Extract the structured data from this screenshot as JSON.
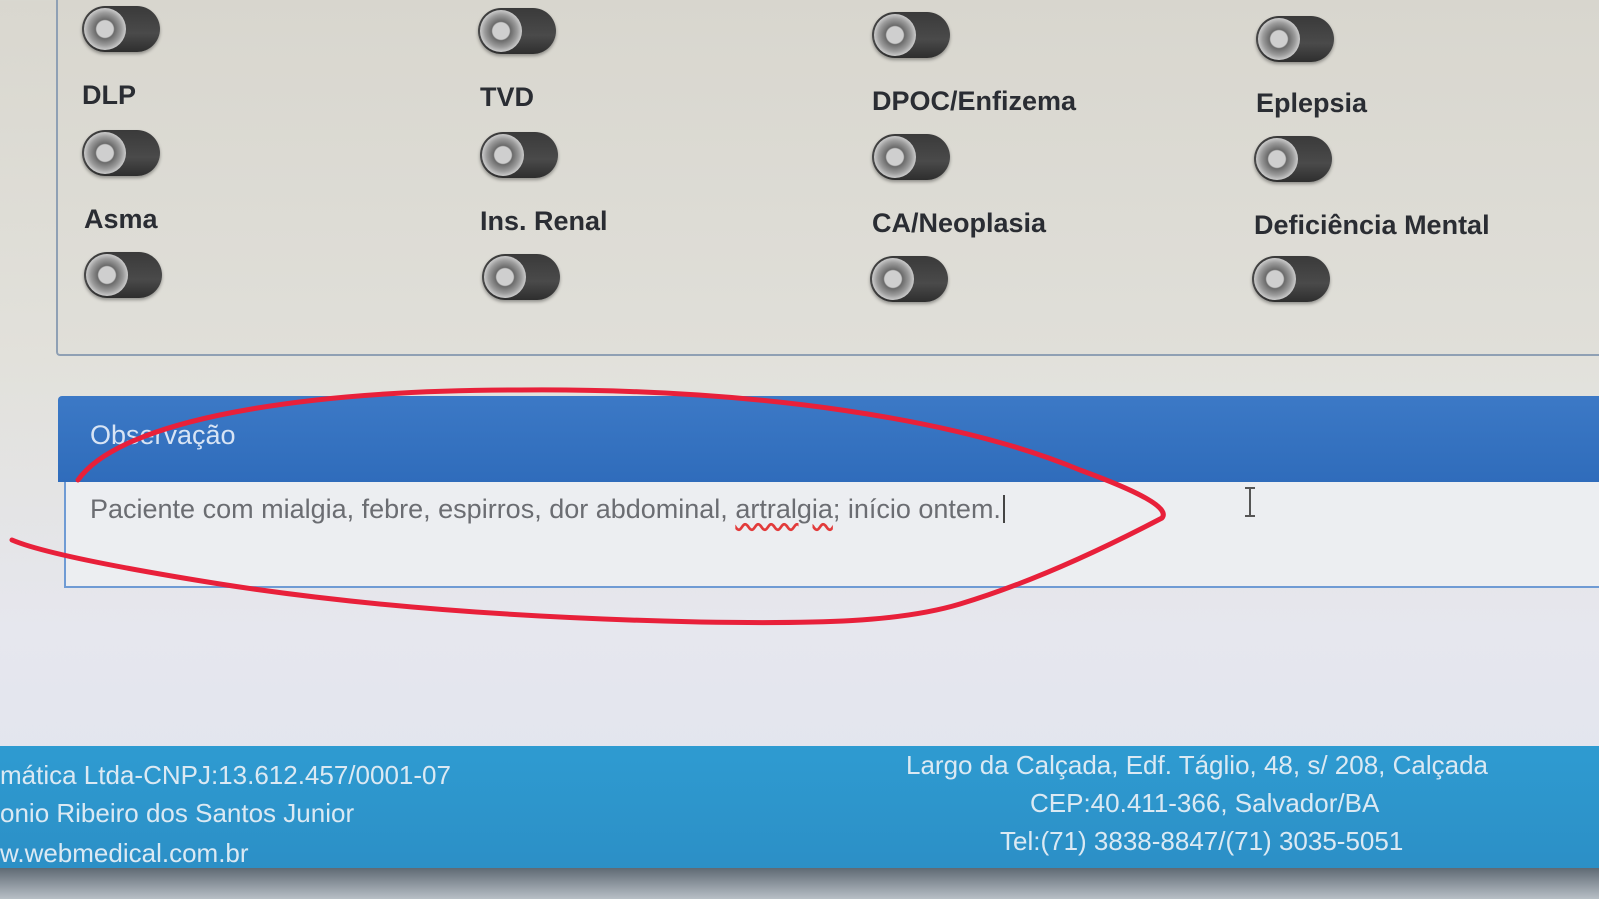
{
  "conditions": {
    "col1": [
      "DLP",
      "Asma"
    ],
    "col2": [
      "TVD",
      "Ins. Renal"
    ],
    "col3": [
      "DPOC/Enfizema",
      "CA/Neoplasia"
    ],
    "col4": [
      "Eplepsia",
      "Deficiência Mental"
    ]
  },
  "toggles_state": "off",
  "observacao": {
    "title": "Observação",
    "text_before": "Paciente com mialgia, febre, espirros, dor abdominal, ",
    "text_misspelled": "artralgia",
    "text_after": "; início ontem."
  },
  "footer": {
    "company": "mática Ltda-CNPJ:13.612.457/0001-07",
    "person": "onio Ribeiro dos Santos Junior",
    "website": "w.webmedical.com.br",
    "address": "Largo da Calçada, Edf. Táglio, 48, s/ 208, Calçada",
    "cep": "CEP:40.411-366, Salvador/BA",
    "tel": "Tel:(71) 3838-8847/(71) 3035-5051"
  },
  "colors": {
    "header_blue": "#2f6cbb",
    "footer_blue": "#2c8fc6",
    "annotation_red": "#e8203a"
  }
}
